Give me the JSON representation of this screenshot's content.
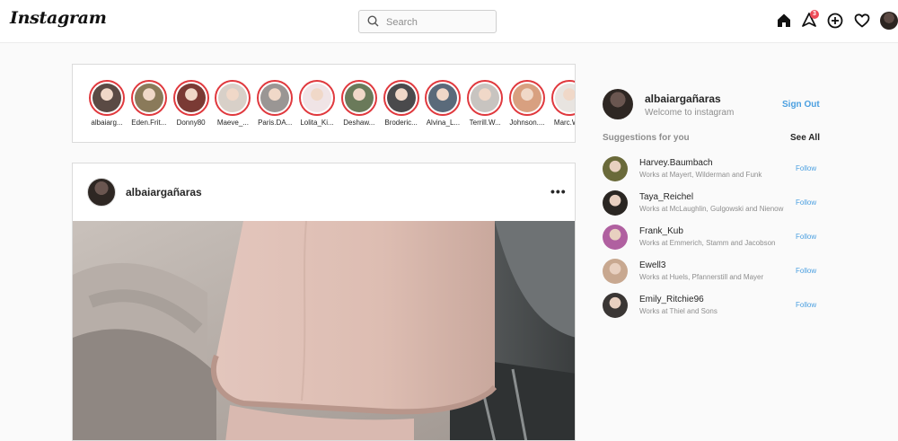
{
  "header": {
    "logo": "Instagram",
    "search_placeholder": "Search",
    "notification_count": "3"
  },
  "stories": [
    {
      "name": "albaiarg...",
      "color": "#5a4a44"
    },
    {
      "name": "Eden.Frit...",
      "color": "#8a7a5a"
    },
    {
      "name": "Donny80",
      "color": "#7a3a34"
    },
    {
      "name": "Maeve_...",
      "color": "#d8d0c8"
    },
    {
      "name": "Paris.DA...",
      "color": "#9a9694"
    },
    {
      "name": "Lolita_Ki...",
      "color": "#f0e4e6"
    },
    {
      "name": "Deshaw...",
      "color": "#6a7a5a"
    },
    {
      "name": "Broderic...",
      "color": "#4a4a4c"
    },
    {
      "name": "Alvina_L...",
      "color": "#5a6a7a"
    },
    {
      "name": "Terrill.W...",
      "color": "#c8c4c0"
    },
    {
      "name": "Johnson....",
      "color": "#d8a080"
    },
    {
      "name": "Marc.W...",
      "color": "#e8e4e0"
    }
  ],
  "post": {
    "username": "albaiargañaras",
    "more": "•••"
  },
  "sidebar": {
    "username": "albaiargañaras",
    "welcome": "Welcome to instagram",
    "sign_out": "Sign Out",
    "suggestions_title": "Suggestions for you",
    "see_all": "See All",
    "suggestions": [
      {
        "name": "Harvey.Baumbach",
        "sub": "Works at Mayert, Wilderman and Funk",
        "follow": "Follow",
        "color": "#6a6a3a"
      },
      {
        "name": "Taya_Reichel",
        "sub": "Works at McLaughlin, Gulgowski and Nienow",
        "follow": "Follow",
        "color": "#2a2622"
      },
      {
        "name": "Frank_Kub",
        "sub": "Works at Emmerich, Stamm and Jacobson",
        "follow": "Follow",
        "color": "#b060a0"
      },
      {
        "name": "Ewell3",
        "sub": "Works at Huels, Pfannerstill and Mayer",
        "follow": "Follow",
        "color": "#c8a890"
      },
      {
        "name": "Emily_Ritchie96",
        "sub": "Works at Thiel and Sons",
        "follow": "Follow",
        "color": "#3a3634"
      }
    ]
  },
  "colors": {
    "accent": "#4a9fe0",
    "story_ring": "#e0393e",
    "badge": "#ed4956"
  }
}
